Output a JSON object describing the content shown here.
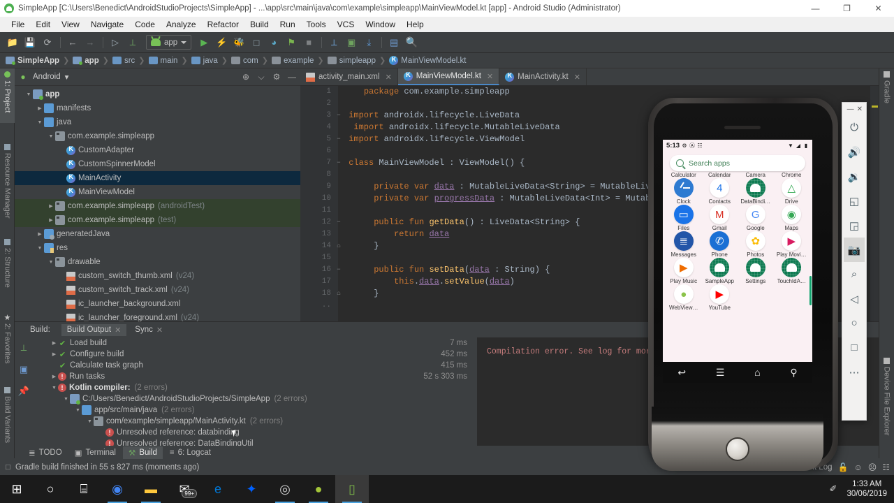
{
  "window": {
    "title": "SimpleApp [C:\\Users\\Benedict\\AndroidStudioProjects\\SimpleApp] - ...\\app\\src\\main\\java\\com\\example\\simpleapp\\MainViewModel.kt [app] - Android Studio (Administrator)",
    "minimize": "—",
    "maximize": "❐",
    "close": "✕",
    "app_icon": "android-studio-icon"
  },
  "menubar": {
    "items": [
      "File",
      "Edit",
      "View",
      "Navigate",
      "Code",
      "Analyze",
      "Refactor",
      "Build",
      "Run",
      "Tools",
      "VCS",
      "Window",
      "Help"
    ]
  },
  "toolbar": {
    "buttons": [
      {
        "name": "open-project-icon",
        "glyph": "📂"
      },
      {
        "name": "save-all-icon",
        "glyph": "💾"
      },
      {
        "name": "sync-project-icon",
        "glyph": "⟳"
      },
      {
        "name": "back-icon",
        "glyph": "←"
      },
      {
        "name": "forward-icon",
        "glyph": "→"
      },
      {
        "name": "avd-manager-icon",
        "glyph": "▶"
      },
      {
        "name": "build-hammer-icon",
        "glyph": "⚒"
      }
    ],
    "run_config": "app",
    "run_buttons": [
      {
        "name": "run-icon",
        "glyph": "▶"
      },
      {
        "name": "apply-changes-icon",
        "glyph": "⚡"
      },
      {
        "name": "debug-icon",
        "glyph": "🐞"
      },
      {
        "name": "attach-debugger-icon",
        "glyph": "⏻"
      },
      {
        "name": "profile-icon",
        "glyph": "◔"
      },
      {
        "name": "run-with-coverage-icon",
        "glyph": "⚑"
      },
      {
        "name": "stop-icon",
        "glyph": "■"
      },
      {
        "name": "sdk-manager-icon",
        "glyph": "⚒"
      },
      {
        "name": "avd-manager-2-icon",
        "glyph": "▣"
      },
      {
        "name": "sync-gradle-icon",
        "glyph": "⤓"
      },
      {
        "name": "project-structure-icon",
        "glyph": "▤"
      },
      {
        "name": "search-everywhere-icon",
        "glyph": "🔍"
      }
    ]
  },
  "breadcrumb": [
    {
      "label": "SimpleApp",
      "icon": "module-icon",
      "bold": true
    },
    {
      "label": "app",
      "icon": "module-icon",
      "bold": true
    },
    {
      "label": "src",
      "icon": "folder-icon",
      "bold": false
    },
    {
      "label": "main",
      "icon": "folder-icon",
      "bold": false
    },
    {
      "label": "java",
      "icon": "folder-icon",
      "bold": false
    },
    {
      "label": "com",
      "icon": "package-icon",
      "bold": false
    },
    {
      "label": "example",
      "icon": "package-icon",
      "bold": false
    },
    {
      "label": "simpleapp",
      "icon": "package-icon",
      "bold": false
    },
    {
      "label": "MainViewModel.kt",
      "icon": "kotlin-file-icon",
      "bold": false
    }
  ],
  "left_strip": [
    {
      "label": "1: Project",
      "active": true
    },
    {
      "label": "Resource Manager",
      "active": false
    },
    {
      "label": "2: Structure",
      "active": false
    },
    {
      "label": "2: Favorites",
      "active": false
    },
    {
      "label": "Build Variants",
      "active": false
    }
  ],
  "right_strip": [
    {
      "label": "Gradle"
    },
    {
      "label": "Device File Explorer"
    }
  ],
  "project_panel": {
    "title": "Android",
    "dropdown_caret": "▾",
    "actions": [
      {
        "name": "locate-icon",
        "glyph": "⊕"
      },
      {
        "name": "collapse-all-icon",
        "glyph": "⌵"
      },
      {
        "name": "settings-gear-icon",
        "glyph": "⚙"
      },
      {
        "name": "hide-panel-icon",
        "glyph": "—"
      }
    ],
    "tree": [
      {
        "indent": 0,
        "arrow": "▼",
        "icon": "module-icon",
        "label": "app",
        "suffix": "",
        "bold": true,
        "state": ""
      },
      {
        "indent": 1,
        "arrow": "▶",
        "icon": "folder-icon",
        "label": "manifests",
        "suffix": "",
        "bold": false,
        "state": ""
      },
      {
        "indent": 1,
        "arrow": "▼",
        "icon": "folder-icon",
        "label": "java",
        "suffix": "",
        "bold": false,
        "state": ""
      },
      {
        "indent": 2,
        "arrow": "▼",
        "icon": "package-icon",
        "label": "com.example.simpleapp",
        "suffix": "",
        "bold": false,
        "state": ""
      },
      {
        "indent": 3,
        "arrow": "",
        "icon": "kotlin-file-icon",
        "label": "CustomAdapter",
        "suffix": "",
        "bold": false,
        "state": ""
      },
      {
        "indent": 3,
        "arrow": "",
        "icon": "kotlin-file-icon",
        "label": "CustomSpinnerModel",
        "suffix": "",
        "bold": false,
        "state": ""
      },
      {
        "indent": 3,
        "arrow": "",
        "icon": "kotlin-file-icon",
        "label": "MainActivity",
        "suffix": "",
        "bold": false,
        "state": "selected"
      },
      {
        "indent": 3,
        "arrow": "",
        "icon": "kotlin-file-icon",
        "label": "MainViewModel",
        "suffix": "",
        "bold": false,
        "state": ""
      },
      {
        "indent": 2,
        "arrow": "▶",
        "icon": "package-icon",
        "label": "com.example.simpleapp",
        "suffix": "(androidTest)",
        "bold": false,
        "state": "test"
      },
      {
        "indent": 2,
        "arrow": "▶",
        "icon": "package-icon",
        "label": "com.example.simpleapp",
        "suffix": "(test)",
        "bold": false,
        "state": "test"
      },
      {
        "indent": 1,
        "arrow": "▶",
        "icon": "generated-folder-icon",
        "label": "generatedJava",
        "suffix": "",
        "bold": false,
        "state": ""
      },
      {
        "indent": 1,
        "arrow": "▼",
        "icon": "res-folder-icon",
        "label": "res",
        "suffix": "",
        "bold": false,
        "state": ""
      },
      {
        "indent": 2,
        "arrow": "▼",
        "icon": "package-icon",
        "label": "drawable",
        "suffix": "",
        "bold": false,
        "state": ""
      },
      {
        "indent": 3,
        "arrow": "",
        "icon": "xml-file-icon",
        "label": "custom_switch_thumb.xml",
        "suffix": "(v24)",
        "bold": false,
        "state": ""
      },
      {
        "indent": 3,
        "arrow": "",
        "icon": "xml-file-icon",
        "label": "custom_switch_track.xml",
        "suffix": "(v24)",
        "bold": false,
        "state": ""
      },
      {
        "indent": 3,
        "arrow": "",
        "icon": "xml-file-icon",
        "label": "ic_launcher_background.xml",
        "suffix": "",
        "bold": false,
        "state": ""
      },
      {
        "indent": 3,
        "arrow": "",
        "icon": "xml-file-icon",
        "label": "ic_launcher_foreground.xml",
        "suffix": "(v24)",
        "bold": false,
        "state": ""
      }
    ]
  },
  "editor": {
    "tabs": [
      {
        "label": "activity_main.xml",
        "icon": "xml-file-icon",
        "active": false,
        "close": "✕"
      },
      {
        "label": "MainViewModel.kt",
        "icon": "kotlin-file-icon",
        "active": true,
        "close": "✕"
      },
      {
        "label": "MainActivity.kt",
        "icon": "kotlin-file-icon",
        "active": false,
        "close": "✕"
      }
    ],
    "line_numbers": [
      "1",
      "2",
      "3",
      "4",
      "5",
      "6",
      "7",
      "8",
      "9",
      "10",
      "11",
      "12",
      "13",
      "14",
      "15",
      "16",
      "17",
      "18",
      ".."
    ],
    "code_lines": [
      "    package com.example.simpleapp",
      "",
      " import androidx.lifecycle.LiveData",
      "  import androidx.lifecycle.MutableLiveData",
      " import androidx.lifecycle.ViewModel",
      "",
      " class MainViewModel : ViewModel() {",
      "",
      "      private var data : MutableLiveData<String> = MutableLiv",
      "      private var progressData : MutableLiveData<Int> = Mutab",
      "",
      "      public fun getData() : LiveData<String> {",
      "          return data",
      "      }",
      "",
      "      public fun setData(data : String) {",
      "          this.data.setValue(data)",
      "      }",
      ""
    ]
  },
  "build_panel": {
    "label": "Build:",
    "tabs": [
      {
        "label": "Build Output",
        "active": true,
        "close": "✕"
      },
      {
        "label": "Sync",
        "active": false,
        "close": "✕"
      }
    ],
    "side_actions": [
      {
        "name": "build-hammer-icon",
        "glyph": "⚒"
      },
      {
        "name": "restart-icon",
        "glyph": "⏵"
      },
      {
        "name": "pin-tab-icon",
        "glyph": "📌"
      }
    ],
    "rows": [
      {
        "indent": 1,
        "arrow": "▶",
        "status": "ok",
        "label": "Load build",
        "suffix": "",
        "bold": false,
        "time": "7 ms"
      },
      {
        "indent": 1,
        "arrow": "▶",
        "status": "ok",
        "label": "Configure build",
        "suffix": "",
        "bold": false,
        "time": "452 ms"
      },
      {
        "indent": 1,
        "arrow": "",
        "status": "ok",
        "label": "Calculate task graph",
        "suffix": "",
        "bold": false,
        "time": "415 ms"
      },
      {
        "indent": 1,
        "arrow": "▶",
        "status": "error",
        "label": "Run tasks",
        "suffix": "",
        "bold": false,
        "time": "52 s 303 ms"
      },
      {
        "indent": 1,
        "arrow": "▼",
        "status": "error",
        "label": "Kotlin compiler:",
        "suffix": "(2 errors)",
        "bold": true,
        "time": ""
      },
      {
        "indent": 2,
        "arrow": "▼",
        "status": "module",
        "label": "C:/Users/Benedict/AndroidStudioProjects/SimpleApp",
        "suffix": "(2 errors)",
        "bold": false,
        "time": ""
      },
      {
        "indent": 3,
        "arrow": "▼",
        "status": "folder",
        "label": "app/src/main/java",
        "suffix": "(2 errors)",
        "bold": false,
        "time": ""
      },
      {
        "indent": 4,
        "arrow": "▼",
        "status": "package",
        "label": "com/example/simpleapp/MainActivity.kt",
        "suffix": "(2 errors)",
        "bold": false,
        "time": ""
      },
      {
        "indent": 5,
        "arrow": "",
        "status": "error",
        "label": "Unresolved reference: databinding",
        "suffix": "",
        "bold": false,
        "time": ""
      },
      {
        "indent": 5,
        "arrow": "",
        "status": "error",
        "label": "Unresolved reference: DataBindingUtil",
        "suffix": "",
        "bold": false,
        "time": ""
      }
    ],
    "log_text": "Compilation error. See log for mor"
  },
  "bottom_tabs": [
    {
      "label": "TODO",
      "icon": "todo-icon",
      "glyph": "≣",
      "active": false
    },
    {
      "label": "Terminal",
      "icon": "terminal-icon",
      "glyph": "▣",
      "active": false
    },
    {
      "label": "Build",
      "icon": "build-hammer-icon",
      "glyph": "⚒",
      "active": true
    },
    {
      "label": "6: Logcat",
      "icon": "logcat-icon",
      "glyph": "≡",
      "active": false
    }
  ],
  "status_bar": {
    "icon": "gradle-sync-icon",
    "glyph": "□",
    "message": "Gradle build finished in 55 s 827 ms (moments ago)",
    "event_log": "Event Log",
    "right_icons": [
      {
        "name": "lock-icon",
        "glyph": "🔓"
      },
      {
        "name": "happy-face-icon",
        "glyph": "☺"
      },
      {
        "name": "neutral-face-icon",
        "glyph": "☹"
      },
      {
        "name": "memory-indicator-icon",
        "glyph": "☷"
      }
    ]
  },
  "emulator": {
    "window_controls": {
      "minimize": "—",
      "close": "✕"
    },
    "side_tools": [
      {
        "name": "power-icon",
        "glyph": "⏻",
        "selected": false
      },
      {
        "name": "volume-up-icon",
        "glyph": "🔊",
        "selected": false
      },
      {
        "name": "volume-down-icon",
        "glyph": "🔉",
        "selected": false
      },
      {
        "name": "rotate-left-icon",
        "glyph": "◱",
        "selected": false
      },
      {
        "name": "rotate-right-icon",
        "glyph": "◲",
        "selected": false
      },
      {
        "name": "screenshot-camera-icon",
        "glyph": "📷",
        "selected": true
      },
      {
        "name": "zoom-icon",
        "glyph": "⌕",
        "selected": false
      },
      {
        "name": "back-triangle-icon",
        "glyph": "◁",
        "selected": false
      },
      {
        "name": "home-circle-icon",
        "glyph": "○",
        "selected": false
      },
      {
        "name": "overview-square-icon",
        "glyph": "□",
        "selected": false
      },
      {
        "name": "more-options-icon",
        "glyph": "⋯",
        "selected": false
      }
    ],
    "screen": {
      "status_bar": {
        "time": "5:13",
        "icons": [
          {
            "name": "settings-gear-icon",
            "glyph": "⚙"
          },
          {
            "name": "accessibility-icon",
            "glyph": "Ⓐ"
          },
          {
            "name": "clipboard-icon",
            "glyph": "☷"
          }
        ],
        "right_icons": [
          {
            "name": "wifi-icon",
            "glyph": "▼"
          },
          {
            "name": "signal-icon",
            "glyph": "◢"
          },
          {
            "name": "battery-icon",
            "glyph": "▮"
          }
        ]
      },
      "search": {
        "placeholder": "Search apps",
        "icon": "search-icon"
      },
      "app_rows": [
        [
          {
            "label": "Calculator",
            "icon": "calculator-app-icon",
            "style": "white"
          },
          {
            "label": "Calendar",
            "icon": "calendar-app-icon",
            "style": "white"
          },
          {
            "label": "Camera",
            "icon": "camera-app-icon",
            "style": "white"
          },
          {
            "label": "Chrome",
            "icon": "chrome-app-icon",
            "style": "white"
          }
        ],
        [
          {
            "label": "Clock",
            "icon": "clock-app-icon",
            "style": "clock"
          },
          {
            "label": "Contacts",
            "icon": "contacts-app-icon",
            "style": "white"
          },
          {
            "label": "DataBindi…",
            "icon": "databinding-app-icon",
            "style": "droid"
          },
          {
            "label": "Drive",
            "icon": "drive-app-icon",
            "style": "white"
          }
        ],
        [
          {
            "label": "Files",
            "icon": "files-app-icon",
            "style": "blue"
          },
          {
            "label": "Gmail",
            "icon": "gmail-app-icon",
            "style": "white"
          },
          {
            "label": "Google",
            "icon": "google-app-icon",
            "style": "white"
          },
          {
            "label": "Maps",
            "icon": "maps-app-icon",
            "style": "white"
          }
        ],
        [
          {
            "label": "Messages",
            "icon": "messages-app-icon",
            "style": "blue"
          },
          {
            "label": "Phone",
            "icon": "phone-app-icon",
            "style": "blue"
          },
          {
            "label": "Photos",
            "icon": "photos-app-icon",
            "style": "white"
          },
          {
            "label": "Play Movi…",
            "icon": "play-movies-app-icon",
            "style": "white"
          }
        ],
        [
          {
            "label": "Play Music",
            "icon": "play-music-app-icon",
            "style": "white"
          },
          {
            "label": "SampleApp",
            "icon": "sampleapp-icon",
            "style": "droid"
          },
          {
            "label": "Settings",
            "icon": "settings-app-icon",
            "style": "droid"
          },
          {
            "label": "TouchIdA…",
            "icon": "touchid-app-icon",
            "style": "droid"
          }
        ],
        [
          {
            "label": "WebView…",
            "icon": "webview-app-icon",
            "style": "white"
          },
          {
            "label": "YouTube",
            "icon": "youtube-app-icon",
            "style": "white"
          }
        ]
      ],
      "nav_bar": [
        {
          "name": "back-icon",
          "glyph": "↩"
        },
        {
          "name": "menu-icon",
          "glyph": "☰"
        },
        {
          "name": "home-icon",
          "glyph": "⌂"
        },
        {
          "name": "search-icon",
          "glyph": "⚲"
        }
      ]
    }
  },
  "taskbar": {
    "items": [
      {
        "name": "start-button-icon",
        "glyph": "⊞",
        "running": false,
        "active": false
      },
      {
        "name": "cortana-search-icon",
        "glyph": "○",
        "running": false,
        "active": false
      },
      {
        "name": "task-view-icon",
        "glyph": "⌸",
        "running": false,
        "active": false
      },
      {
        "name": "chrome-taskbar-icon",
        "glyph": "",
        "running": true,
        "active": false
      },
      {
        "name": "file-explorer-taskbar-icon",
        "glyph": "",
        "running": true,
        "active": false
      },
      {
        "name": "mail-taskbar-icon",
        "glyph": "",
        "badge": "99+",
        "running": false,
        "active": false
      },
      {
        "name": "edge-taskbar-icon",
        "glyph": "",
        "running": false,
        "active": false
      },
      {
        "name": "dropbox-taskbar-icon",
        "glyph": "",
        "running": false,
        "active": false
      },
      {
        "name": "obs-taskbar-icon",
        "glyph": "",
        "running": true,
        "active": false
      },
      {
        "name": "android-studio-taskbar-icon",
        "glyph": "",
        "running": true,
        "active": false
      },
      {
        "name": "emulator-taskbar-icon",
        "glyph": "",
        "running": true,
        "active": true
      }
    ],
    "tray": {
      "pen_icon": "pen-icon",
      "pen_glyph": "✐",
      "time": "1:33 AM",
      "date": "30/06/2019"
    }
  }
}
